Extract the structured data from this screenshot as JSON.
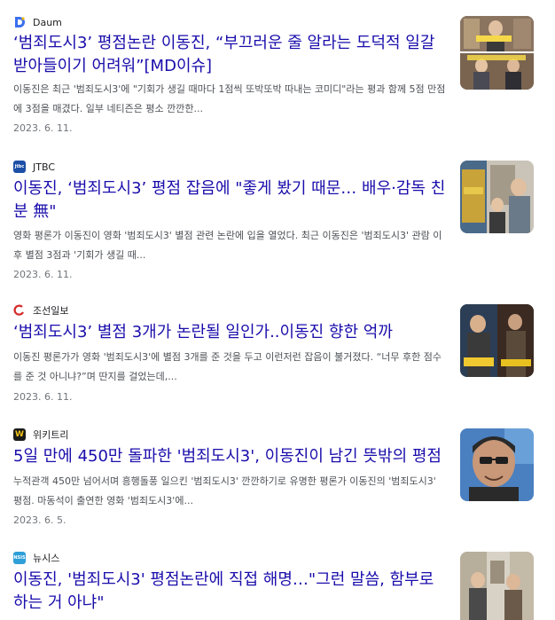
{
  "results": [
    {
      "source": "Daum",
      "source_icon": "daum-icon",
      "title": "‘범죄도시3’ 평점논란 이동진, “부끄러운 줄 알라는 도덕적 일갈 받아들이기 어려워”[MD이슈]",
      "snippet": "이동진은 최근 '범죄도시3'에 \"기회가 생길 때마다 1점씩 또박또박 따내는 코미디\"라는 평과 함께 5점 만점에 3점을 매겼다. 일부 네티즌은 평소 깐깐한...",
      "date": "2023. 6. 11."
    },
    {
      "source": "JTBC",
      "source_icon": "jtbc-icon",
      "title": "이동진, ‘범죄도시3’ 평점 잡음에 \"좋게 봤기 때문… 배우·감독 친분 無\"",
      "snippet": "영화 평론가 이동진이 영화 '범죄도시3' 별점 관련 논란에 입을 열었다. 최근 이동진은 '범죄도시3' 관람 이후 별점 3점과 '기회가 생길 때...",
      "date": "2023. 6. 11."
    },
    {
      "source": "조선일보",
      "source_icon": "chosun-icon",
      "title": "‘범죄도시3’ 별점 3개가 논란될 일인가..이동진 향한 억까",
      "snippet": "이동진 평론가가 영화 '범죄도시3'에 별점 3개를 준 것을 두고 이런저런 잡음이 불거졌다. “너무 후한 점수를 준 것 아니냐?”며 딴지를 걸었는데,...",
      "date": "2023. 6. 11."
    },
    {
      "source": "위키트리",
      "source_icon": "wikitree-icon",
      "title": "5일 만에 450만 돌파한 '범죄도시3', 이동진이 남긴 뜻밖의 평점",
      "snippet": "누적관객 450만 넘어서며 흥행돌풍 일으킨 '범죄도시3' 깐깐하기로 유명한 평론가 이동진의 '범죄도시3' 평점. 마동석이 출연한 영화 '범죄도시3'에...",
      "date": "2023. 6. 5."
    },
    {
      "source": "뉴시스",
      "source_icon": "newsis-icon",
      "title": "이동진, '범죄도시3' 평점논란에 직접 해명…\"그런 말씀, 함부로 하는 거 아냐\"",
      "snippet": "",
      "date": ""
    }
  ],
  "colors": {
    "title": "#1a0dab",
    "snippet": "#4d5156",
    "date": "#70757a"
  }
}
